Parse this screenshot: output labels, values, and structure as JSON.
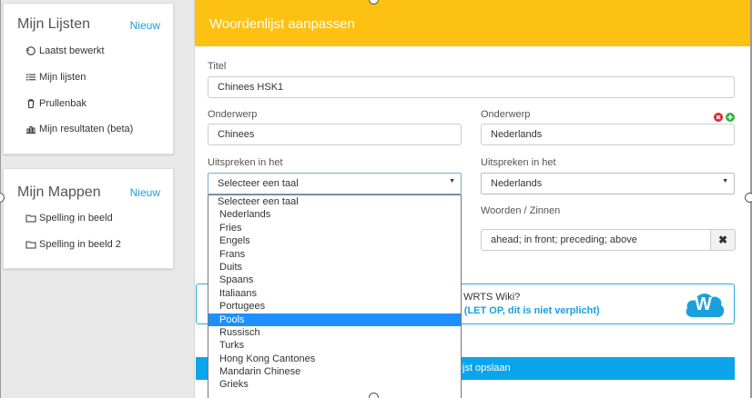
{
  "lists_panel": {
    "title": "Mijn Lijsten",
    "new_label": "Nieuw",
    "items": [
      {
        "label": "Laatst bewerkt",
        "icon": "history-icon"
      },
      {
        "label": "Mijn lijsten",
        "icon": "list-icon"
      },
      {
        "label": "Prullenbak",
        "icon": "trash-icon"
      },
      {
        "label": "Mijn resultaten (beta)",
        "icon": "bar-chart-icon"
      }
    ]
  },
  "folders_panel": {
    "title": "Mijn Mappen",
    "new_label": "Nieuw",
    "items": [
      {
        "label": "Spelling in beeld",
        "icon": "folder-icon"
      },
      {
        "label": "Spelling in beeld 2",
        "icon": "folder-icon"
      }
    ]
  },
  "editor": {
    "header": "Woordenlijst aanpassen",
    "title_label": "Titel",
    "title_value": "Chinees HSK1",
    "subject_left_label": "Onderwerp",
    "subject_left_value": "Chinees",
    "subject_right_label": "Onderwerp",
    "subject_right_value": "Nederlands",
    "pron_left_label": "Uitspreken in het",
    "pron_left_value": "Selecteer een taal",
    "pron_right_label": "Uitspreken in het",
    "pron_right_value": "Nederlands",
    "words_label": "Woorden / Zinnen",
    "word_value": "ahead; in front; preceding; above",
    "clear_symbol": "✖",
    "remove_color": "#e0242f",
    "add_color": "#2eb03c"
  },
  "dropdown": {
    "selected_index": 10,
    "options": [
      "Selecteer een taal",
      "Nederlands",
      "Fries",
      "Engels",
      "Frans",
      "Duits",
      "Spaans",
      "Italiaans",
      "Portugees",
      "Pools",
      "Russisch",
      "Turks",
      "Hong Kong Cantones",
      "Mandarin Chinese",
      "Grieks"
    ]
  },
  "wiki": {
    "question_partial": "e WRTS Wiki?",
    "link_partial": "n (LET OP, dit is niet verplicht)",
    "logo_letter": "W"
  },
  "save": {
    "label_partial": "nlijst opslaan"
  },
  "colors": {
    "header_yellow": "#fdc112",
    "accent_blue": "#0ba5ec",
    "link_blue": "#1a9fd8",
    "selected_option": "#1e90ff"
  }
}
